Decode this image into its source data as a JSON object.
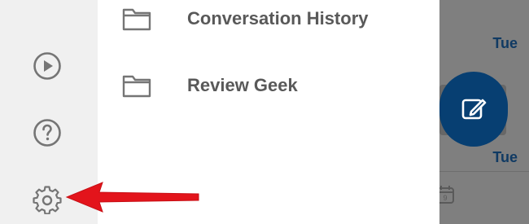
{
  "background_app": {
    "dates": [
      "Tue",
      "Tue"
    ],
    "compose_icon": "compose-pencil-icon",
    "calendar_icon": "calendar-icon"
  },
  "rail": {
    "items": [
      {
        "icon": "play-icon"
      },
      {
        "icon": "help-icon"
      },
      {
        "icon": "gear-icon"
      }
    ]
  },
  "folders": [
    {
      "label": "Conversation History",
      "icon": "folder-icon"
    },
    {
      "label": "Review Geek",
      "icon": "folder-icon"
    }
  ],
  "annotation": {
    "type": "red-arrow",
    "color": "#e3141b",
    "points_to": "gear-icon"
  },
  "colors": {
    "accent": "#073f72",
    "date_text": "#103a63",
    "rail_bg": "#f0f0f0",
    "icon_gray": "#757575",
    "label_gray": "#595959",
    "dim_overlay": "#7f7f7f"
  }
}
